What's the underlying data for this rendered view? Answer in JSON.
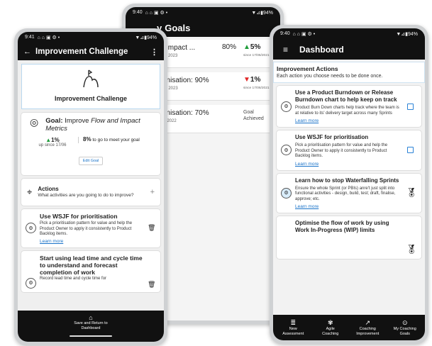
{
  "middle": {
    "status": {
      "time": "9:40",
      "icons": "⌂ ⌂ ▣ ⚙ •",
      "battery": "▼⊿▮94%"
    },
    "title": "Goals",
    "title_partial": "y",
    "goals": [
      {
        "name": "l Impact ...",
        "pct": "80%",
        "change": "5%",
        "dir": "up",
        "since": "since 17/06/2021",
        "date": "ay 2023"
      },
      {
        "name": "anisation: 90%",
        "change": "1%",
        "dir": "down",
        "since": "since 17/06/2021",
        "date": "on 2023"
      },
      {
        "name": "anisation: 70%",
        "achieved": "Goal Achieved",
        "date": "ct 2022"
      }
    ]
  },
  "left": {
    "status": {
      "time": "9:41",
      "icons": "⌂ ⌂ ▣ ⚙ •",
      "battery": "▼⊿▮94%"
    },
    "header": {
      "title": "Improvement Challenge",
      "back": "←",
      "menu": "⋮"
    },
    "hero": {
      "title": "Improvement Challenge"
    },
    "goal": {
      "label": "Goal:",
      "text": "Improve ",
      "text_em": "Flow and Impact Metrics",
      "change": "1%",
      "since": "up since 17/06",
      "remaining": "8%",
      "remaining_text": "to go to meet your goal",
      "edit_label": "Edit Goal"
    },
    "actions": {
      "title": "Actions",
      "prompt": "What activities are you going to do to improve?",
      "add": "+"
    },
    "items": [
      {
        "title": "Use WSJF for prioritisation",
        "desc": "Pick a prioritisation pattern for value and help the Product Owner to apply it consistently to Product Backlog items.",
        "link": "Learn more"
      },
      {
        "title": "Start using lead time and cycle time to understand and forecast completion of work",
        "desc": "Record lead time and cycle time for"
      }
    ],
    "save": {
      "label": "Save and Return to Dashboard"
    }
  },
  "right": {
    "status": {
      "time": "9:40",
      "icons": "⌂ ⌂ ▣ ⚙ •",
      "battery": "▼⊿▮94%"
    },
    "header": {
      "title": "Dashboard",
      "menu": "≡"
    },
    "banner": {
      "title": "Improvement Actions",
      "sub": "Each action you choose needs to be done once."
    },
    "items": [
      {
        "title": "Use a Product Burndown or Release Burndown chart to help keep on track",
        "desc": "Product Burn Down charts help track where the team is at relative to its' delivery target across many Sprints",
        "link": "Learn more",
        "control": "checkbox"
      },
      {
        "title": "Use WSJF for prioritisation",
        "desc": "Pick a prioritisation pattern for value and help the Product Owner to apply it consistently to Product Backlog items.",
        "link": "Learn more",
        "control": "checkbox"
      },
      {
        "title": "Learn how to stop Waterfalling Sprints",
        "desc": "Ensure the whole Sprint (or PBIs) anre't just split into functional activities - design, build, test; draft, finalise, approve; etc.",
        "link": "Learn more",
        "control": "medal"
      },
      {
        "title": "Optimise the flow of work by using Work In-Progress (WIP) limits",
        "control": "medal"
      }
    ],
    "nav": [
      {
        "icon": "≣",
        "label": "New Assessment"
      },
      {
        "icon": "✾",
        "label": "Agile Coaching"
      },
      {
        "icon": "↗",
        "label": "Coaching Improvement"
      },
      {
        "icon": "⊙",
        "label": "My Coaching Goals"
      }
    ]
  },
  "colors": {
    "up": "#1f9d3a",
    "down": "#e02626",
    "link": "#1a73c9",
    "accent": "#2a82d6",
    "appbar": "#111111"
  }
}
